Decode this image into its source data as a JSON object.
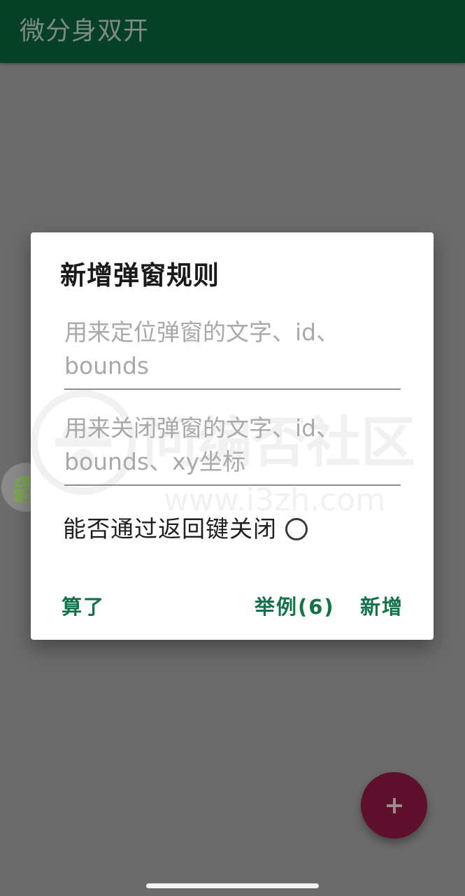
{
  "app": {
    "title": "微分身双开"
  },
  "dialog": {
    "title": "新增弹窗规则",
    "locate_field": {
      "value": "",
      "placeholder": "用来定位弹窗的文字、id、bounds"
    },
    "close_field": {
      "value": "",
      "placeholder": "用来关闭弹窗的文字、id、bounds、xy坐标"
    },
    "back_key_toggle": {
      "label": "能否通过返回键关闭",
      "checked": false
    },
    "buttons": {
      "cancel": "算了",
      "example": "举例(6)",
      "add": "新增"
    }
  },
  "fab": {
    "icon": "plus-icon"
  },
  "floating_bubble": {
    "icon": "android-icon"
  },
  "colors": {
    "app_bar": "#064026",
    "accent": "#12724a",
    "fab": "#5e0f2c",
    "scrim": "#6b6b6b"
  }
}
